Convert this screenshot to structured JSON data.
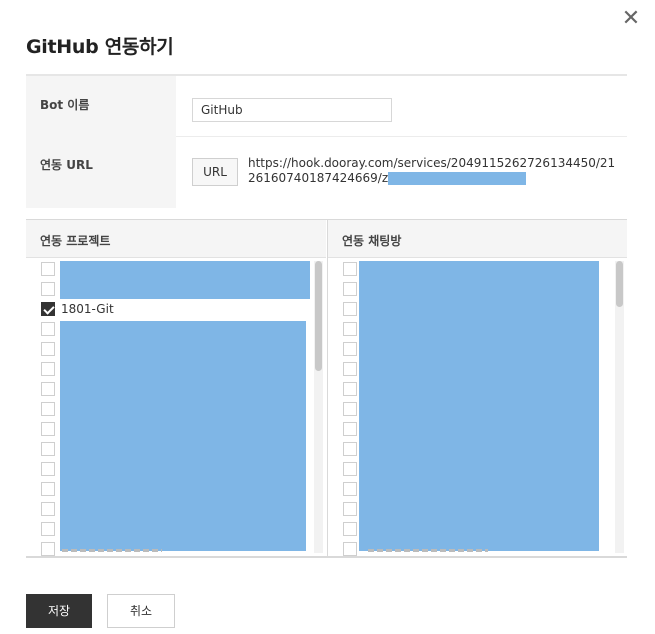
{
  "dialog": {
    "title": "GitHub 연동하기",
    "close_icon": "✕"
  },
  "form": {
    "bot_name_label": "Bot 이름",
    "bot_name_value": "GitHub",
    "url_label": "연동 URL",
    "url_button": "URL",
    "url_value": "https://hook.dooray.com/services/2049115262726134450/2126160740187424669/z"
  },
  "projects": {
    "header": "연동 프로젝트",
    "checked_item": "1801-Git"
  },
  "chat_rooms": {
    "header": "연동 채팅방"
  },
  "buttons": {
    "save": "저장",
    "cancel": "취소"
  },
  "colors": {
    "redaction": "#7fb6e6",
    "primary_button": "#333333"
  }
}
